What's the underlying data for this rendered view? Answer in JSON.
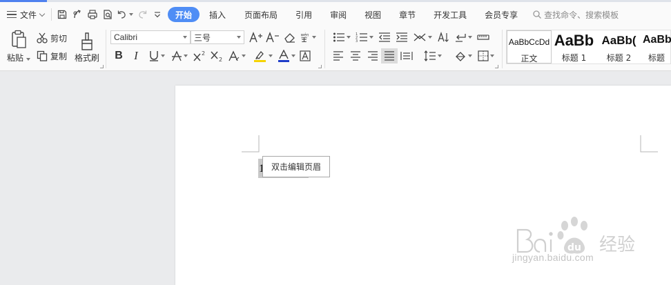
{
  "app": {
    "progress_fraction": 0.07
  },
  "menubar": {
    "file_label": "文件",
    "tabs": [
      {
        "label": "开始",
        "active": true
      },
      {
        "label": "插入"
      },
      {
        "label": "页面布局"
      },
      {
        "label": "引用"
      },
      {
        "label": "审阅"
      },
      {
        "label": "视图"
      },
      {
        "label": "章节"
      },
      {
        "label": "开发工具"
      },
      {
        "label": "会员专享"
      }
    ],
    "search_placeholder": "查找命令、搜索模板"
  },
  "ribbon": {
    "paste_label": "粘贴",
    "cut_label": "剪切",
    "copy_label": "复制",
    "format_painter_label": "格式刷",
    "font_name": "Calibri",
    "font_size": "三号",
    "styles": [
      {
        "sample": "AaBbCcDd",
        "name": "正文"
      },
      {
        "sample": "AaBb",
        "name": "标题 1"
      },
      {
        "sample": "AaBb(",
        "name": "标题 2"
      },
      {
        "sample": "AaBb",
        "name": "标题"
      }
    ]
  },
  "document": {
    "page_number_text": "1",
    "tooltip_text": "双击编辑页眉"
  },
  "watermark": {
    "brand_text": "Bai du 经验",
    "url_text": "jingyan.baidu.com"
  },
  "colors": {
    "accent": "#4f8df5",
    "highlight_yellow": "#f5d300",
    "font_color_blue": "#1f3ec9",
    "page_bg": "#ffffff",
    "doc_bg": "#eaebed"
  }
}
